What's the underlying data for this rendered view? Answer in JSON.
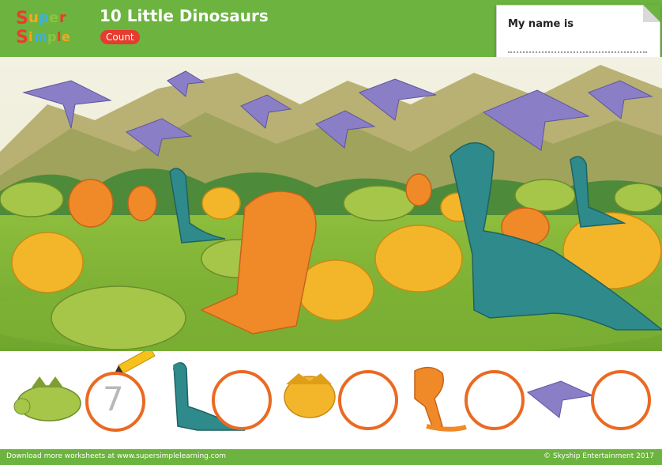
{
  "header": {
    "logo_line1": "Super",
    "logo_line2": "Simple",
    "title": "10 Little Dinosaurs",
    "badge": "Count"
  },
  "name_box": {
    "label": "My name is"
  },
  "answers": {
    "example_digit": "7",
    "items": [
      {
        "dinosaur": "stegosaurus-icon",
        "answer": "7"
      },
      {
        "dinosaur": "brachiosaurus-icon",
        "answer": ""
      },
      {
        "dinosaur": "triceratops-icon",
        "answer": ""
      },
      {
        "dinosaur": "t-rex-icon",
        "answer": ""
      },
      {
        "dinosaur": "pterodactyl-icon",
        "answer": ""
      }
    ]
  },
  "footer": {
    "left": "Download more worksheets at www.supersimplelearning.com",
    "right": "© Skyship Entertainment 2017"
  },
  "colors": {
    "header_green": "#6cb33f",
    "badge_red": "#e63b2e",
    "circle_orange": "#ea6a22"
  }
}
